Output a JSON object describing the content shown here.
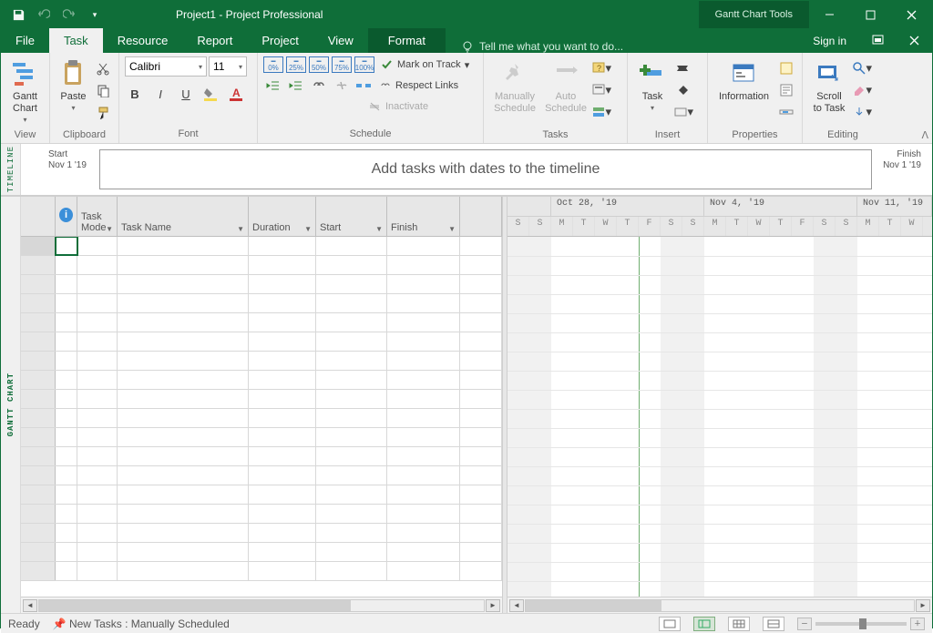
{
  "title": "Project1 - Project Professional",
  "toolContext": "Gantt Chart Tools",
  "tabs": {
    "file": "File",
    "task": "Task",
    "resource": "Resource",
    "report": "Report",
    "project": "Project",
    "view": "View",
    "format": "Format"
  },
  "tellMe": "Tell me what you want to do...",
  "signIn": "Sign in",
  "ribbon": {
    "view": {
      "ganttChart": "Gantt\nChart",
      "label": "View"
    },
    "clipboard": {
      "paste": "Paste",
      "label": "Clipboard"
    },
    "font": {
      "name": "Calibri",
      "size": "11",
      "label": "Font"
    },
    "schedule": {
      "pcts": [
        "0%",
        "25%",
        "50%",
        "75%",
        "100%"
      ],
      "markOnTrack": "Mark on Track",
      "respectLinks": "Respect Links",
      "inactivate": "Inactivate",
      "manually": "Manually\nSchedule",
      "auto": "Auto\nSchedule",
      "label": "Schedule"
    },
    "tasks": {
      "label": "Tasks"
    },
    "insert": {
      "task": "Task",
      "label": "Insert"
    },
    "properties": {
      "information": "Information",
      "label": "Properties"
    },
    "editing": {
      "scrollToTask": "Scroll\nto Task",
      "label": "Editing"
    }
  },
  "timeline": {
    "startLabel": "Start",
    "startDate": "Nov 1 '19",
    "finishLabel": "Finish",
    "finishDate": "Nov 1 '19",
    "placeholder": "Add tasks with dates to the timeline",
    "vlabel": "TIMELINE"
  },
  "grid": {
    "vlabel": "GANTT CHART",
    "cols": {
      "mode": "Task\nMode",
      "name": "Task Name",
      "duration": "Duration",
      "start": "Start",
      "finish": "Finish"
    },
    "weeks": [
      "Oct 28, '19",
      "Nov 4, '19",
      "Nov 11, '19"
    ],
    "days": [
      "S",
      "S",
      "M",
      "T",
      "W",
      "T",
      "F",
      "S",
      "S",
      "M",
      "T",
      "W",
      "T",
      "F",
      "S",
      "S",
      "M",
      "T",
      "W"
    ]
  },
  "status": {
    "ready": "Ready",
    "newTasks": "New Tasks : Manually Scheduled"
  }
}
